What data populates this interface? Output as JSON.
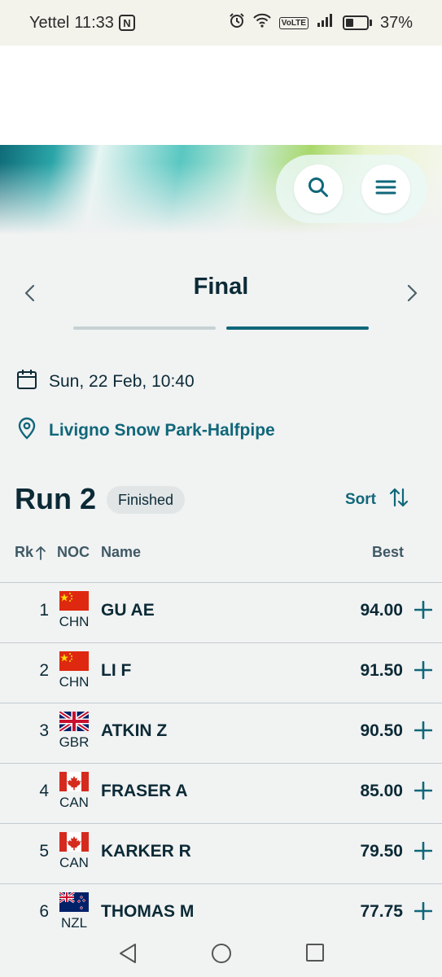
{
  "status_bar": {
    "carrier": "Yettel",
    "time": "11:33",
    "nfc": "N",
    "volte": "VoLTE",
    "battery": "37%",
    "battery_level": 0.37
  },
  "header": {
    "search_icon": "search-icon",
    "menu_icon": "menu-icon"
  },
  "stage": {
    "title": "Final",
    "segments": 2,
    "active_segment": 2
  },
  "event": {
    "date": "Sun, 22 Feb, 10:40",
    "venue": "Livigno Snow Park-Halfpipe"
  },
  "run": {
    "title": "Run 2",
    "status": "Finished",
    "sort_label": "Sort"
  },
  "table": {
    "headers": {
      "rank": "Rk",
      "noc": "NOC",
      "name": "Name",
      "best": "Best"
    },
    "rows": [
      {
        "rank": "1",
        "noc": "CHN",
        "name": "GU AE",
        "best": "94.00"
      },
      {
        "rank": "2",
        "noc": "CHN",
        "name": "LI F",
        "best": "91.50"
      },
      {
        "rank": "3",
        "noc": "GBR",
        "name": "ATKIN Z",
        "best": "90.50"
      },
      {
        "rank": "4",
        "noc": "CAN",
        "name": "FRASER A",
        "best": "85.00"
      },
      {
        "rank": "5",
        "noc": "CAN",
        "name": "KARKER R",
        "best": "79.50"
      },
      {
        "rank": "6",
        "noc": "NZL",
        "name": "THOMAS M",
        "best": "77.75"
      }
    ]
  },
  "colors": {
    "accent": "#10677a",
    "text": "#0b2a36",
    "background": "#f1f2f2"
  }
}
